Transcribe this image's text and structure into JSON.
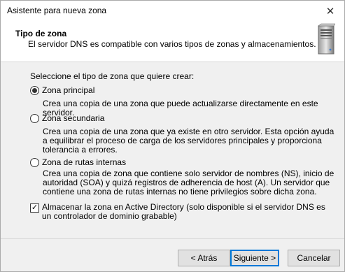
{
  "window": {
    "title": "Asistente para nueva zona",
    "close_label": "✕"
  },
  "header": {
    "title": "Tipo de zona",
    "description": "El servidor DNS es compatible con varios tipos de zonas y almacenamientos."
  },
  "content": {
    "prompt": "Seleccione el tipo de zona que quiere crear:",
    "options": [
      {
        "label": "Zona principal",
        "selected": true,
        "description": "Crea una copia de una zona que puede actualizarse directamente en este servidor."
      },
      {
        "label": "Zona secundaria",
        "selected": false,
        "description": "Crea una copia de una zona que ya existe en otro servidor. Esta opción ayuda a equilibrar el proceso de carga de los servidores principales y proporciona tolerancia a errores."
      },
      {
        "label": "Zona de rutas internas",
        "selected": false,
        "description": "Crea una copia de zona que contiene solo servidor de nombres (NS), inicio de autoridad (SOA) y quizá registros de adherencia de host (A). Un servidor que contiene una zona de rutas internas no tiene privilegios sobre dicha zona."
      }
    ],
    "ad_checkbox": {
      "checked": true,
      "label": "Almacenar la zona en Active Directory (solo disponible si el servidor DNS es un controlador de dominio grabable)"
    }
  },
  "buttons": {
    "back": "< Atrás",
    "next": "Siguiente >",
    "cancel": "Cancelar"
  },
  "icons": {
    "header_icon": "server-icon",
    "close": "close-icon"
  }
}
